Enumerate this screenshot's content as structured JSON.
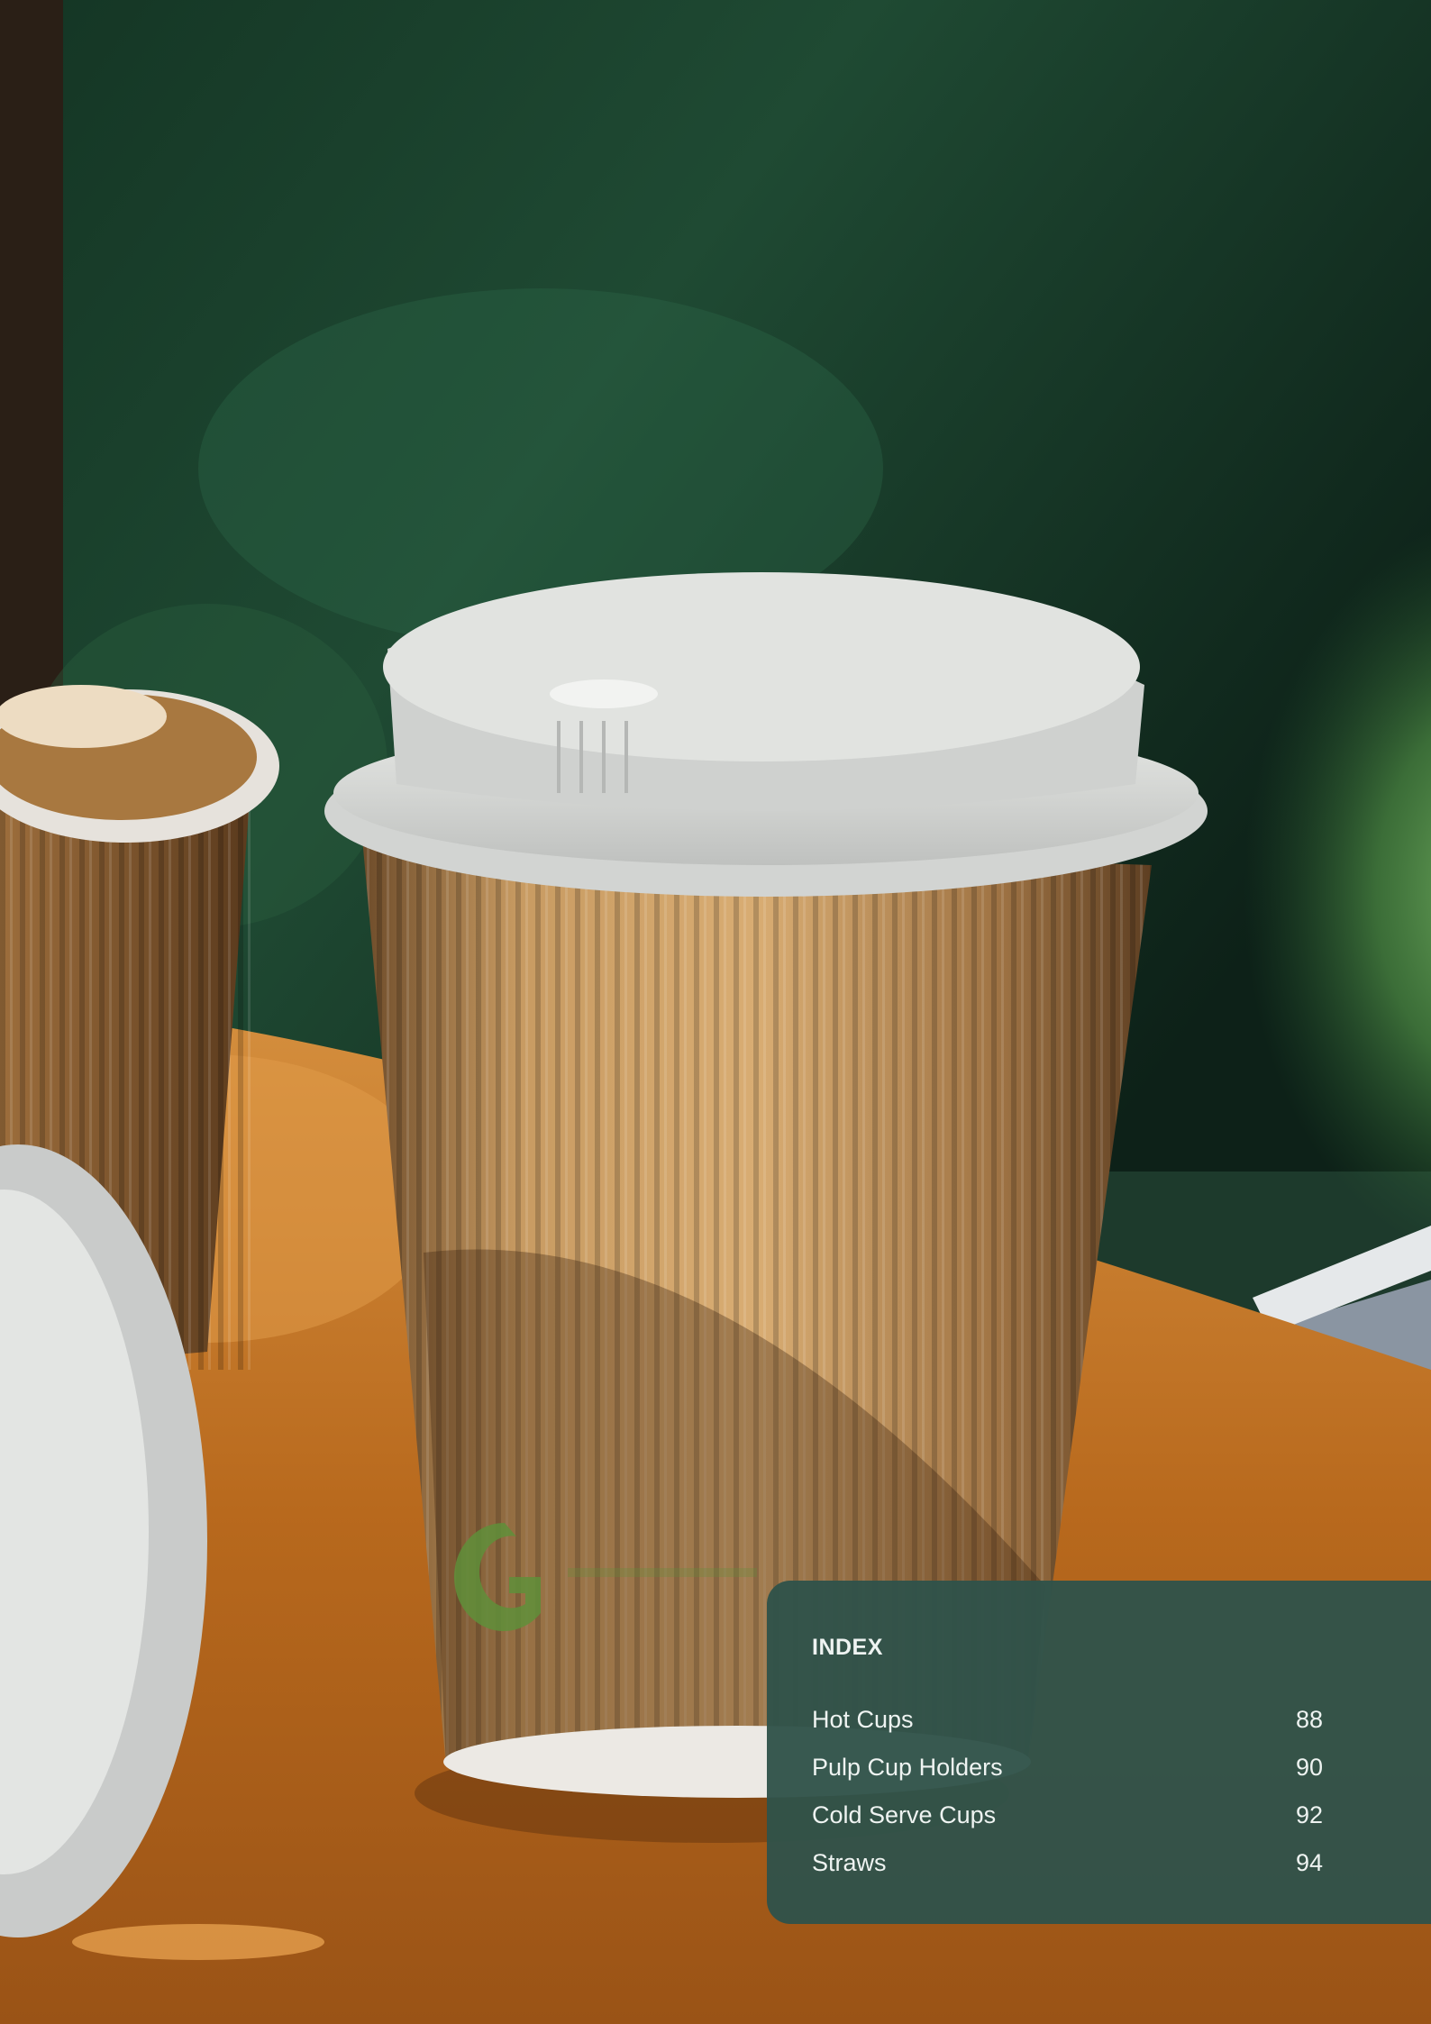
{
  "index": {
    "title": "INDEX",
    "entries": [
      {
        "label": "Hot Cups",
        "page": "88"
      },
      {
        "label": "Pulp Cup Holders",
        "page": "90"
      },
      {
        "label": "Cold Serve Cups",
        "page": "92"
      },
      {
        "label": "Straws",
        "page": "94"
      }
    ]
  },
  "colors": {
    "panel": "#30524a",
    "panel_text": "#eef3f1",
    "kraft": "#b0844f",
    "lid": "#d4d6d4",
    "table": "#c57a2a",
    "foliage": "#2d5a3c"
  },
  "photo": {
    "subject": "kraft-ripple-hot-cup-with-white-lid-on-wooden-table",
    "logo_text": "GREEN"
  }
}
